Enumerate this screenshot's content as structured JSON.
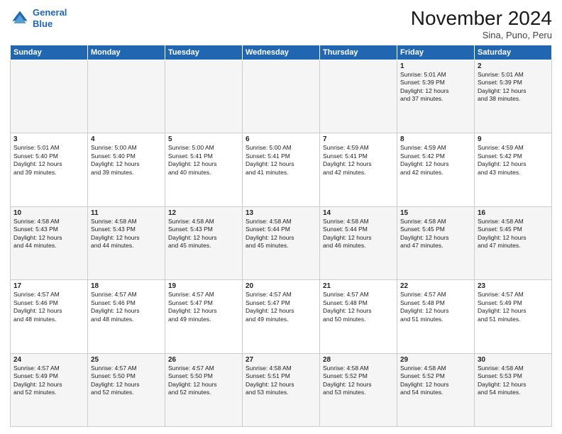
{
  "header": {
    "logo_line1": "General",
    "logo_line2": "Blue",
    "month_title": "November 2024",
    "location": "Sina, Puno, Peru"
  },
  "days_of_week": [
    "Sunday",
    "Monday",
    "Tuesday",
    "Wednesday",
    "Thursday",
    "Friday",
    "Saturday"
  ],
  "weeks": [
    [
      {
        "day": "",
        "info": ""
      },
      {
        "day": "",
        "info": ""
      },
      {
        "day": "",
        "info": ""
      },
      {
        "day": "",
        "info": ""
      },
      {
        "day": "",
        "info": ""
      },
      {
        "day": "1",
        "info": "Sunrise: 5:01 AM\nSunset: 5:39 PM\nDaylight: 12 hours\nand 37 minutes."
      },
      {
        "day": "2",
        "info": "Sunrise: 5:01 AM\nSunset: 5:39 PM\nDaylight: 12 hours\nand 38 minutes."
      }
    ],
    [
      {
        "day": "3",
        "info": "Sunrise: 5:01 AM\nSunset: 5:40 PM\nDaylight: 12 hours\nand 39 minutes."
      },
      {
        "day": "4",
        "info": "Sunrise: 5:00 AM\nSunset: 5:40 PM\nDaylight: 12 hours\nand 39 minutes."
      },
      {
        "day": "5",
        "info": "Sunrise: 5:00 AM\nSunset: 5:41 PM\nDaylight: 12 hours\nand 40 minutes."
      },
      {
        "day": "6",
        "info": "Sunrise: 5:00 AM\nSunset: 5:41 PM\nDaylight: 12 hours\nand 41 minutes."
      },
      {
        "day": "7",
        "info": "Sunrise: 4:59 AM\nSunset: 5:41 PM\nDaylight: 12 hours\nand 42 minutes."
      },
      {
        "day": "8",
        "info": "Sunrise: 4:59 AM\nSunset: 5:42 PM\nDaylight: 12 hours\nand 42 minutes."
      },
      {
        "day": "9",
        "info": "Sunrise: 4:59 AM\nSunset: 5:42 PM\nDaylight: 12 hours\nand 43 minutes."
      }
    ],
    [
      {
        "day": "10",
        "info": "Sunrise: 4:58 AM\nSunset: 5:43 PM\nDaylight: 12 hours\nand 44 minutes."
      },
      {
        "day": "11",
        "info": "Sunrise: 4:58 AM\nSunset: 5:43 PM\nDaylight: 12 hours\nand 44 minutes."
      },
      {
        "day": "12",
        "info": "Sunrise: 4:58 AM\nSunset: 5:43 PM\nDaylight: 12 hours\nand 45 minutes."
      },
      {
        "day": "13",
        "info": "Sunrise: 4:58 AM\nSunset: 5:44 PM\nDaylight: 12 hours\nand 45 minutes."
      },
      {
        "day": "14",
        "info": "Sunrise: 4:58 AM\nSunset: 5:44 PM\nDaylight: 12 hours\nand 46 minutes."
      },
      {
        "day": "15",
        "info": "Sunrise: 4:58 AM\nSunset: 5:45 PM\nDaylight: 12 hours\nand 47 minutes."
      },
      {
        "day": "16",
        "info": "Sunrise: 4:58 AM\nSunset: 5:45 PM\nDaylight: 12 hours\nand 47 minutes."
      }
    ],
    [
      {
        "day": "17",
        "info": "Sunrise: 4:57 AM\nSunset: 5:46 PM\nDaylight: 12 hours\nand 48 minutes."
      },
      {
        "day": "18",
        "info": "Sunrise: 4:57 AM\nSunset: 5:46 PM\nDaylight: 12 hours\nand 48 minutes."
      },
      {
        "day": "19",
        "info": "Sunrise: 4:57 AM\nSunset: 5:47 PM\nDaylight: 12 hours\nand 49 minutes."
      },
      {
        "day": "20",
        "info": "Sunrise: 4:57 AM\nSunset: 5:47 PM\nDaylight: 12 hours\nand 49 minutes."
      },
      {
        "day": "21",
        "info": "Sunrise: 4:57 AM\nSunset: 5:48 PM\nDaylight: 12 hours\nand 50 minutes."
      },
      {
        "day": "22",
        "info": "Sunrise: 4:57 AM\nSunset: 5:48 PM\nDaylight: 12 hours\nand 51 minutes."
      },
      {
        "day": "23",
        "info": "Sunrise: 4:57 AM\nSunset: 5:49 PM\nDaylight: 12 hours\nand 51 minutes."
      }
    ],
    [
      {
        "day": "24",
        "info": "Sunrise: 4:57 AM\nSunset: 5:49 PM\nDaylight: 12 hours\nand 52 minutes."
      },
      {
        "day": "25",
        "info": "Sunrise: 4:57 AM\nSunset: 5:50 PM\nDaylight: 12 hours\nand 52 minutes."
      },
      {
        "day": "26",
        "info": "Sunrise: 4:57 AM\nSunset: 5:50 PM\nDaylight: 12 hours\nand 52 minutes."
      },
      {
        "day": "27",
        "info": "Sunrise: 4:58 AM\nSunset: 5:51 PM\nDaylight: 12 hours\nand 53 minutes."
      },
      {
        "day": "28",
        "info": "Sunrise: 4:58 AM\nSunset: 5:52 PM\nDaylight: 12 hours\nand 53 minutes."
      },
      {
        "day": "29",
        "info": "Sunrise: 4:58 AM\nSunset: 5:52 PM\nDaylight: 12 hours\nand 54 minutes."
      },
      {
        "day": "30",
        "info": "Sunrise: 4:58 AM\nSunset: 5:53 PM\nDaylight: 12 hours\nand 54 minutes."
      }
    ]
  ]
}
